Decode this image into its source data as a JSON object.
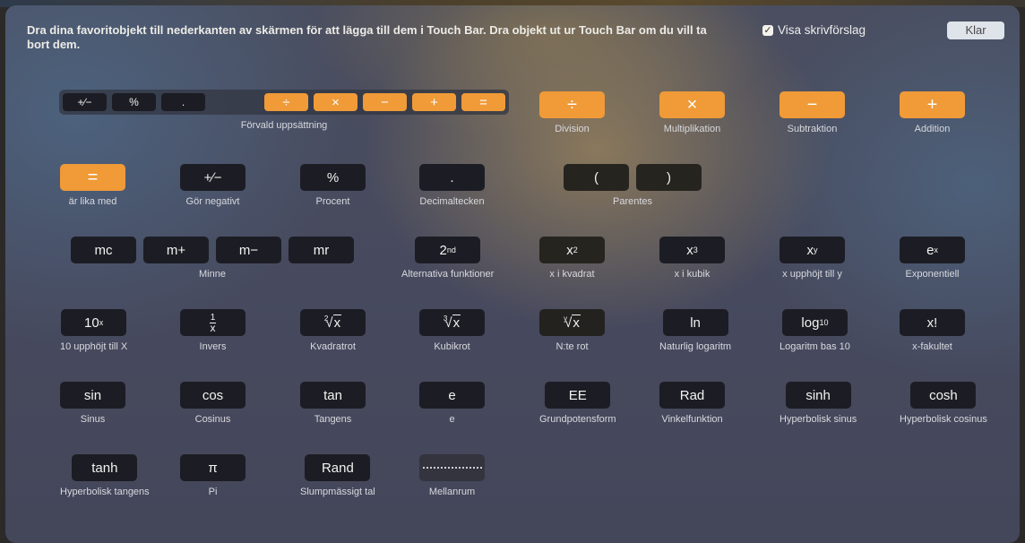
{
  "header": {
    "instruction": "Dra dina favoritobjekt till nederkanten av skärmen för att lägga till dem i Touch Bar. Dra objekt ut ur Touch Bar om du vill ta bort dem.",
    "checkbox_label": "Visa skrivförslag",
    "checkbox_checked": true,
    "checkmark": "✓",
    "done_label": "Klar"
  },
  "colors": {
    "accent_orange": "#f09a38",
    "key_dark": "#1c1d24",
    "done_button": "#dfe3ea"
  },
  "default_set": {
    "label": "Förvald uppsättning",
    "keys": [
      "+∕−",
      "%",
      ".",
      "÷",
      "×",
      "−",
      "+",
      "="
    ]
  },
  "items": {
    "division": {
      "key": "÷",
      "label": "Division"
    },
    "multiplication": {
      "key": "×",
      "label": "Multiplikation"
    },
    "subtraction": {
      "key": "−",
      "label": "Subtraktion"
    },
    "addition": {
      "key": "+",
      "label": "Addition"
    },
    "equals": {
      "key": "=",
      "label": "är lika med"
    },
    "negate": {
      "key": "+∕−",
      "label": "Gör negativt"
    },
    "percent": {
      "key": "%",
      "label": "Procent"
    },
    "decimal": {
      "key": ".",
      "label": "Decimaltecken"
    },
    "parentheses": {
      "keys": [
        "(",
        ")"
      ],
      "label": "Parentes"
    },
    "memory": {
      "keys": [
        "mc",
        "m+",
        "m−",
        "mr"
      ],
      "label": "Minne"
    },
    "second": {
      "base": "2",
      "sup": "nd",
      "label": "Alternativa funktioner"
    },
    "square": {
      "base": "x",
      "sup": "2",
      "label": "x i kvadrat"
    },
    "cube": {
      "base": "x",
      "sup": "3",
      "label": "x i kubik"
    },
    "power": {
      "base": "x",
      "sup": "y",
      "label": "x upphöjt till y"
    },
    "exp": {
      "base": "e",
      "sup": "x",
      "label": "Exponentiell"
    },
    "ten_power": {
      "base": "10",
      "sup": "x",
      "label": "10 upphöjt till X"
    },
    "inverse": {
      "num": "1",
      "den": "x",
      "label": "Invers"
    },
    "sqrt": {
      "index": "2",
      "rad": "x",
      "label": "Kvadratrot"
    },
    "cbrt": {
      "index": "3",
      "rad": "x",
      "label": "Kubikrot"
    },
    "nroot": {
      "index": "y",
      "rad": "x",
      "label": "N:te rot"
    },
    "ln": {
      "key": "ln",
      "label": "Naturlig logaritm"
    },
    "log10": {
      "base": "log",
      "sub": "10",
      "label": "Logaritm bas 10"
    },
    "factorial": {
      "key": "x!",
      "label": "x-fakultet"
    },
    "sin": {
      "key": "sin",
      "label": "Sinus"
    },
    "cos": {
      "key": "cos",
      "label": "Cosinus"
    },
    "tan": {
      "key": "tan",
      "label": "Tangens"
    },
    "e": {
      "key": "e",
      "label": "e"
    },
    "ee": {
      "key": "EE",
      "label": "Grundpotensform"
    },
    "rad": {
      "key": "Rad",
      "label": "Vinkelfunktion"
    },
    "sinh": {
      "key": "sinh",
      "label": "Hyperbolisk sinus"
    },
    "cosh": {
      "key": "cosh",
      "label": "Hyperbolisk cosinus"
    },
    "tanh": {
      "key": "tanh",
      "label": "Hyperbolisk tangens"
    },
    "pi": {
      "key": "π",
      "label": "Pi"
    },
    "rand": {
      "key": "Rand",
      "label": "Slumpmässigt tal"
    },
    "space": {
      "label": "Mellanrum"
    }
  }
}
